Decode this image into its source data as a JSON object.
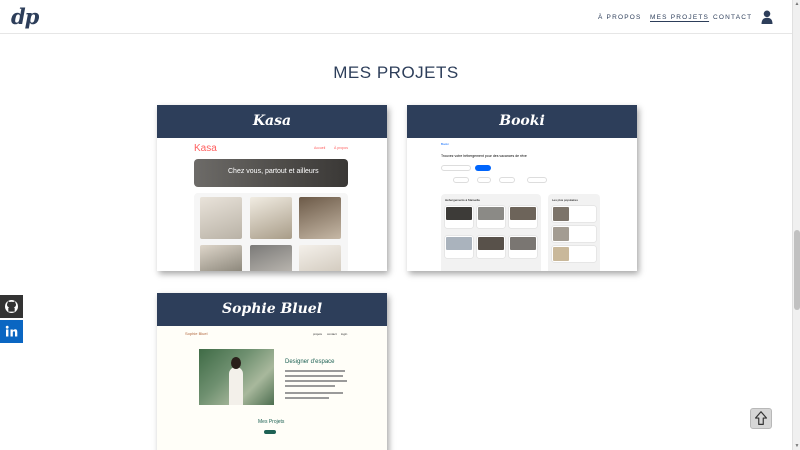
{
  "header": {
    "logo": "dp",
    "nav": [
      {
        "label": "À PROPOS"
      },
      {
        "label": "MES PROJETS"
      },
      {
        "label": "CONTACT"
      }
    ]
  },
  "section": {
    "title": "MES PROJETS"
  },
  "projects": [
    {
      "title": "Kasa",
      "preview": {
        "logo": "Kasa",
        "nav1": "Accueil",
        "nav2": "À propos",
        "banner": "Chez vous, partout et ailleurs"
      }
    },
    {
      "title": "Booki",
      "preview": {
        "headline": "Trouvez votre hébergement pour des vacances de rêve",
        "section1": "Hébergements à Marseille",
        "section2": "Les plus populaires"
      }
    },
    {
      "title": "Sophie Bluel",
      "preview": {
        "brand": "Sophie Bluel",
        "heading": "Designer d'espace",
        "projects": "Mes Projets"
      }
    }
  ],
  "social": [
    {
      "name": "GitHub",
      "color": "#333333"
    },
    {
      "name": "LinkedIn",
      "color": "#0a66c2"
    }
  ],
  "colors": {
    "primary": "#2d3e5a",
    "kasa": "#ff6060",
    "booki": "#0065fc",
    "sophie": "#1d6154"
  }
}
